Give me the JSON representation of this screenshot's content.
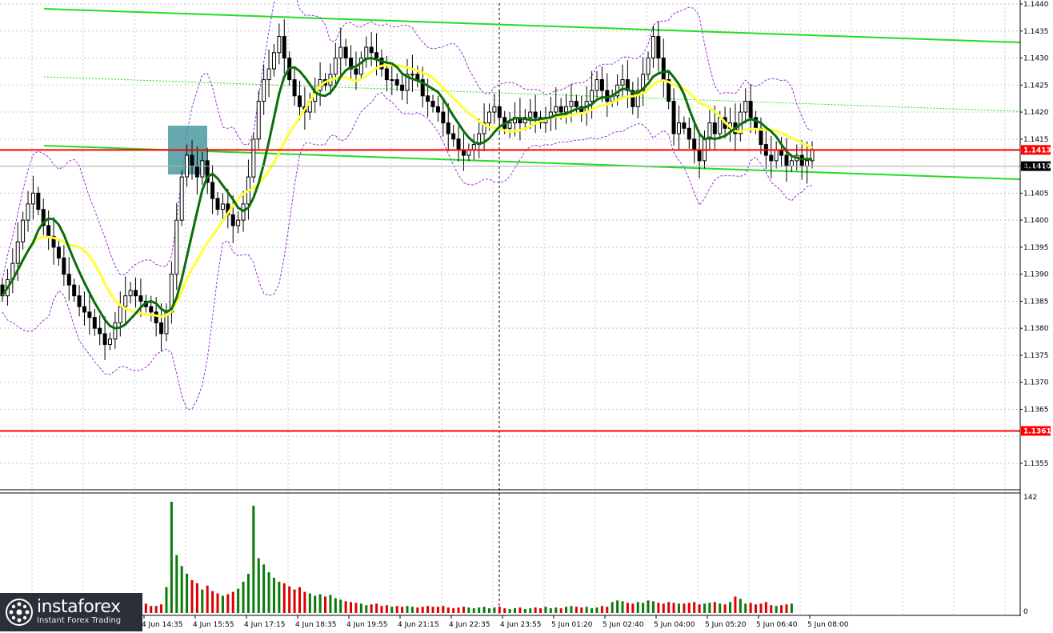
{
  "chart_data": {
    "type": "candlestick",
    "symbol_colors": {
      "bull_candle": "#ffffff",
      "bear_candle": "#000000",
      "ma_fast": "#0a6e0a",
      "ma_slow": "#ffff33",
      "bollinger": "#9b30d9",
      "trendline": "#22dd22",
      "level_line": "#ff0000",
      "volume_up": "#0a7a0a",
      "volume_down": "#dd0000",
      "entry_box": "#4a9aa0"
    },
    "price_axis": {
      "min": 1.135,
      "max": 1.144,
      "ticks": [
        "1.1440",
        "1.1435",
        "1.1430",
        "1.1425",
        "1.1420",
        "1.1415",
        "1.1410",
        "1.1405",
        "1.1400",
        "1.1395",
        "1.1390",
        "1.1385",
        "1.1380",
        "1.1375",
        "1.1370",
        "1.1365",
        "1.1361",
        "1.1355"
      ]
    },
    "current_price_label": "1.1410",
    "levels": [
      {
        "label": "1.1413",
        "price": 1.1413
      },
      {
        "label": "1.1361",
        "price": 1.1361
      }
    ],
    "time_labels": [
      "4 Jun 14:35",
      "4 Jun 15:55",
      "4 Jun 17:15",
      "4 Jun 18:35",
      "4 Jun 19:55",
      "4 Jun 21:15",
      "4 Jun 22:35",
      "4 Jun 23:55",
      "5 Jun 01:20",
      "5 Jun 02:40",
      "5 Jun 04:00",
      "5 Jun 05:20",
      "5 Jun 06:40",
      "5 Jun 08:00"
    ],
    "volume_axis": {
      "max_label": "142",
      "zero_label": "0",
      "max": 142
    },
    "candles_close": [
      1.1386,
      1.1389,
      1.1392,
      1.1396,
      1.14,
      1.1403,
      1.1405,
      1.1402,
      1.1399,
      1.1397,
      1.1395,
      1.1393,
      1.139,
      1.1388,
      1.1386,
      1.1384,
      1.1383,
      1.1382,
      1.138,
      1.1379,
      1.1377,
      1.1378,
      1.1381,
      1.1384,
      1.1386,
      1.1387,
      1.1386,
      1.1385,
      1.1384,
      1.1383,
      1.1381,
      1.1379,
      1.1383,
      1.139,
      1.14,
      1.1408,
      1.1412,
      1.141,
      1.1408,
      1.1411,
      1.1407,
      1.1404,
      1.1402,
      1.1403,
      1.1401,
      1.1399,
      1.14,
      1.1403,
      1.1408,
      1.1415,
      1.1422,
      1.1426,
      1.1428,
      1.1431,
      1.1434,
      1.143,
      1.1426,
      1.1423,
      1.1421,
      1.142,
      1.1422,
      1.1424,
      1.1426,
      1.1425,
      1.1427,
      1.143,
      1.1432,
      1.143,
      1.1428,
      1.1427,
      1.143,
      1.1432,
      1.1431,
      1.143,
      1.1428,
      1.1426,
      1.1426,
      1.1425,
      1.1424,
      1.1427,
      1.1427,
      1.1426,
      1.1423,
      1.1422,
      1.1421,
      1.142,
      1.1418,
      1.1416,
      1.1415,
      1.1413,
      1.1412,
      1.1413,
      1.1414,
      1.1416,
      1.1418,
      1.142,
      1.1421,
      1.1419,
      1.1417,
      1.1418,
      1.1419,
      1.1418,
      1.1419,
      1.142,
      1.1419,
      1.1418,
      1.1419,
      1.142,
      1.1421,
      1.142,
      1.1421,
      1.1422,
      1.1421,
      1.142,
      1.1422,
      1.1424,
      1.1426,
      1.1424,
      1.1422,
      1.1423,
      1.1425,
      1.1426,
      1.1424,
      1.1421,
      1.1424,
      1.1427,
      1.143,
      1.1434,
      1.143,
      1.1426,
      1.1422,
      1.1416,
      1.1418,
      1.1417,
      1.1415,
      1.1413,
      1.1411,
      1.1415,
      1.1418,
      1.1416,
      1.1419,
      1.1417,
      1.1418,
      1.1416,
      1.142,
      1.1422,
      1.1419,
      1.1417,
      1.1414,
      1.1412,
      1.1411,
      1.1413,
      1.1412,
      1.141,
      1.1411,
      1.1412,
      1.141,
      1.1411,
      1.1413
    ],
    "volumes": [
      19,
      15,
      9,
      12,
      8,
      7,
      16,
      13,
      10,
      9,
      8,
      11,
      9,
      10,
      12,
      8,
      9,
      7,
      10,
      8,
      12,
      9,
      16,
      10,
      9,
      11,
      8,
      10,
      12,
      9,
      9,
      11,
      33,
      142,
      74,
      60,
      50,
      42,
      38,
      30,
      35,
      28,
      25,
      22,
      24,
      27,
      31,
      40,
      50,
      137,
      70,
      62,
      52,
      45,
      40,
      38,
      34,
      30,
      33,
      27,
      25,
      22,
      24,
      21,
      23,
      19,
      17,
      15,
      14,
      13,
      12,
      10,
      11,
      12,
      9,
      10,
      8,
      9,
      8,
      9,
      8,
      7,
      8,
      9,
      8,
      8,
      9,
      7,
      6,
      7,
      8,
      7,
      6,
      7,
      8,
      6,
      7,
      8,
      6,
      5,
      6,
      7,
      5,
      6,
      7,
      6,
      8,
      6,
      7,
      6,
      8,
      9,
      8,
      7,
      8,
      6,
      7,
      9,
      8,
      14,
      16,
      15,
      13,
      12,
      14,
      13,
      16,
      15,
      13,
      12,
      14,
      13,
      12,
      12,
      13,
      14,
      11,
      12,
      13,
      14,
      12,
      11,
      14,
      21,
      18,
      12,
      13,
      11,
      12,
      14,
      10,
      9,
      10,
      11,
      12
    ]
  },
  "branding": {
    "name": "instaforex",
    "subtitle": "Instant Forex Trading"
  }
}
